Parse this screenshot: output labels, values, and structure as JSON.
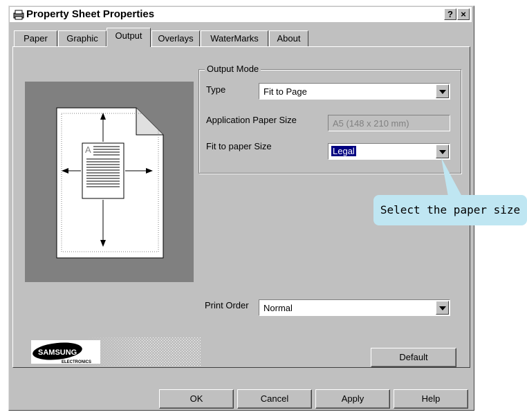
{
  "window": {
    "title": "Property Sheet Properties",
    "help_label": "?",
    "close_label": "×"
  },
  "tabs": [
    {
      "label": "Paper"
    },
    {
      "label": "Graphic"
    },
    {
      "label": "Output"
    },
    {
      "label": "Overlays"
    },
    {
      "label": "WaterMarks"
    },
    {
      "label": "About"
    }
  ],
  "active_tab": "Output",
  "output_mode": {
    "group_label": "Output Mode",
    "type_label": "Type",
    "type_value": "Fit to Page",
    "app_paper_label": "Application Paper Size",
    "app_paper_value": "A5 (148 x 210 mm)",
    "fit_label": "Fit to paper Size",
    "fit_value": "Legal"
  },
  "print_order": {
    "label": "Print Order",
    "value": "Normal"
  },
  "preview": {
    "page_letter": "A"
  },
  "logo": {
    "brand": "SAMSUNG",
    "sub": "ELECTRONICS"
  },
  "buttons": {
    "default": "Default",
    "ok": "OK",
    "cancel": "Cancel",
    "apply": "Apply",
    "help": "Help"
  },
  "callout": {
    "text": "Select the paper size"
  },
  "colors": {
    "dialog_bg": "#c0c0c0",
    "selection": "#000080",
    "callout_bg": "#bfe6f2",
    "preview_bg": "#808080"
  }
}
